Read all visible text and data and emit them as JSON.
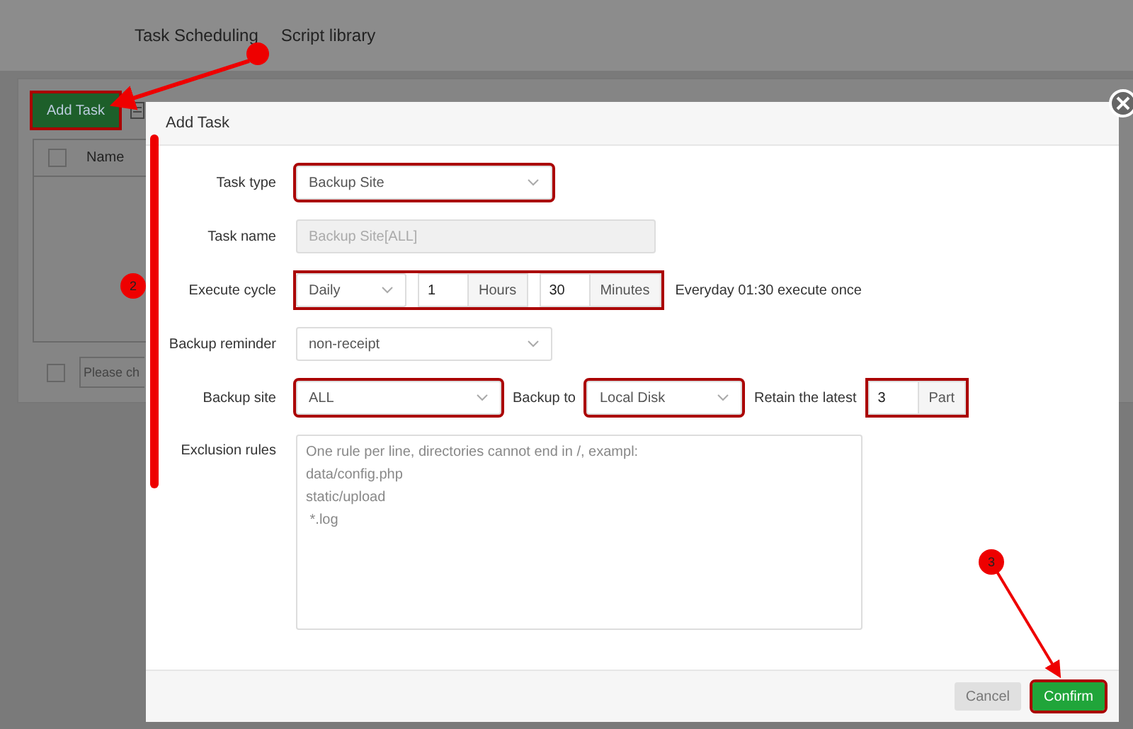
{
  "background": {
    "tabs": [
      {
        "label": "Task Scheduling"
      },
      {
        "label": "Script library"
      }
    ],
    "add_button": {
      "label": "Add Task",
      "highlighted": true
    },
    "table": {
      "select_all": {
        "checked": false
      },
      "columns": [
        "Name"
      ]
    },
    "footer_checkbox": {
      "checked": false
    },
    "footer_field": {
      "placeholder": "Please ch"
    }
  },
  "dialog": {
    "title": "Add Task",
    "rows": [
      {
        "kind": "select",
        "label": "Task type",
        "value": "Backup Site",
        "highlighted": true
      },
      {
        "kind": "text",
        "label": "Task name",
        "value": "Backup Site[ALL]",
        "disabled": true
      },
      {
        "kind": "cycle",
        "label": "Execute cycle",
        "period": "Daily",
        "hours": "1",
        "hours_unit": "Hours",
        "minutes": "30",
        "minutes_unit": "Minutes",
        "summary": "Everyday 01:30 execute once",
        "highlighted": true
      },
      {
        "kind": "select",
        "label": "Backup reminder",
        "value": "non-receipt",
        "highlighted": false
      },
      {
        "kind": "site",
        "label": "Backup site",
        "value": "ALL",
        "to_label": "Backup to",
        "to_value": "Local Disk",
        "retain_label": "Retain the latest",
        "retain_value": "3",
        "retain_unit": "Part",
        "highlighted": true
      },
      {
        "kind": "textarea",
        "label": "Exclusion rules",
        "placeholder": "One rule per line, directories cannot end in /, exampl:\ndata/config.php\nstatic/upload\n *.log"
      }
    ],
    "buttons": [
      {
        "label": "Cancel",
        "kind": "cancel"
      },
      {
        "label": "Confirm",
        "kind": "confirm",
        "highlighted": true
      }
    ]
  },
  "annotations": [
    {
      "label": "2"
    },
    {
      "label": "3"
    }
  ]
}
